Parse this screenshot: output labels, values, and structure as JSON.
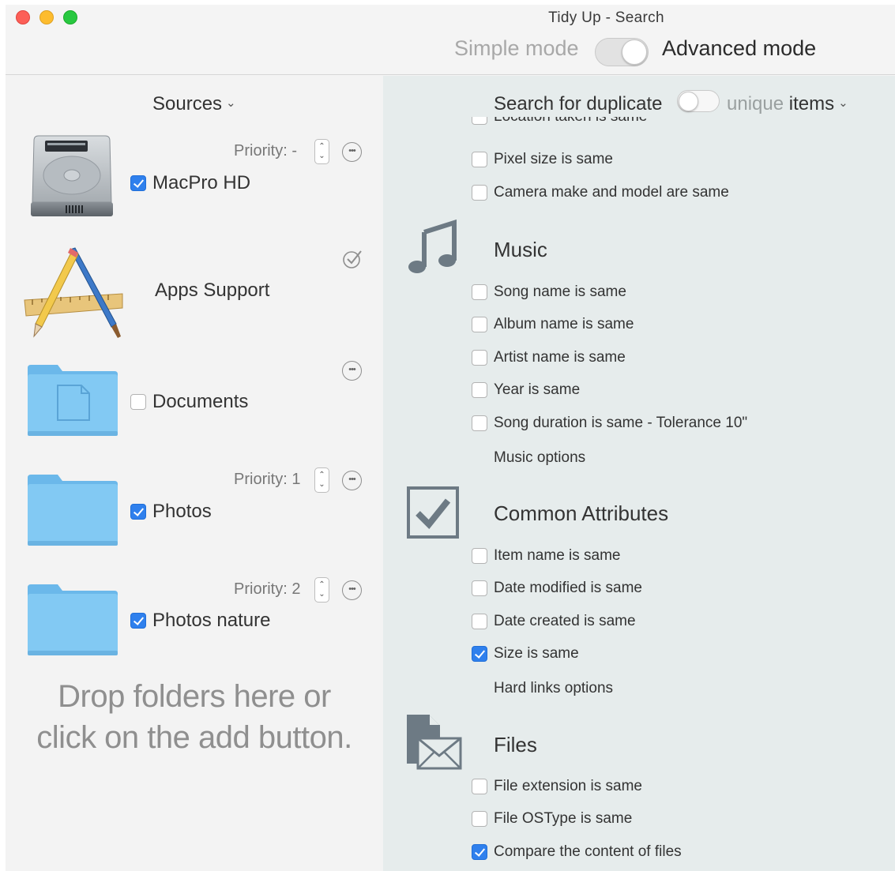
{
  "window": {
    "title": "Tidy Up - Search",
    "simple_mode_label": "Simple mode",
    "advanced_mode_label": "Advanced mode",
    "advanced_mode_on": true
  },
  "sources": {
    "header": "Sources",
    "items": [
      {
        "name": "MacPro HD",
        "priority": "Priority: -",
        "checked": true,
        "icon": "hard-drive-icon"
      },
      {
        "name": "Apps Support",
        "icon": "applications-icon",
        "status_icon": "verified-check-icon"
      },
      {
        "name": "Documents",
        "checked": false,
        "icon": "documents-folder-icon"
      },
      {
        "name": "Photos",
        "priority": "Priority: 1",
        "checked": true,
        "icon": "folder-icon"
      },
      {
        "name": "Photos nature",
        "priority": "Priority: 2",
        "checked": true,
        "icon": "folder-icon"
      }
    ],
    "drop_hint_line1": "Drop folders here or",
    "drop_hint_line2": "click on the add button."
  },
  "search": {
    "label": "Search for duplicate",
    "unique_label": "unique",
    "items_label": "items",
    "clipped_option": "Location taken is same",
    "photo_options": [
      {
        "label": "Pixel size is same",
        "checked": false
      },
      {
        "label": "Camera make and model are same",
        "checked": false
      }
    ],
    "sections": {
      "music": {
        "title": "Music",
        "icon": "music-note-icon",
        "options": [
          {
            "label": "Song name is same",
            "checked": false
          },
          {
            "label": "Album name is same",
            "checked": false
          },
          {
            "label": "Artist name is same",
            "checked": false
          },
          {
            "label": "Year is same",
            "checked": false
          },
          {
            "label": "Song duration is same - Tolerance 10\"",
            "checked": false
          }
        ],
        "link": "Music options"
      },
      "common": {
        "title": "Common Attributes",
        "icon": "checkmark-box-icon",
        "options": [
          {
            "label": "Item name is same",
            "checked": false
          },
          {
            "label": "Date modified is same",
            "checked": false
          },
          {
            "label": "Date created is same",
            "checked": false
          },
          {
            "label": "Size is same",
            "checked": true
          }
        ],
        "link": "Hard links options"
      },
      "files": {
        "title": "Files",
        "icon": "file-envelope-icon",
        "options": [
          {
            "label": "File extension is same",
            "checked": false
          },
          {
            "label": "File OSType is same",
            "checked": false
          },
          {
            "label": "Compare the content of files",
            "checked": true
          }
        ]
      }
    }
  },
  "colors": {
    "accent": "#2f80ed",
    "left_pane": "#f3f3f3",
    "right_pane": "#e6ecec",
    "icon_gray": "#6d7a84",
    "folder_blue": "#7cc4f2"
  }
}
